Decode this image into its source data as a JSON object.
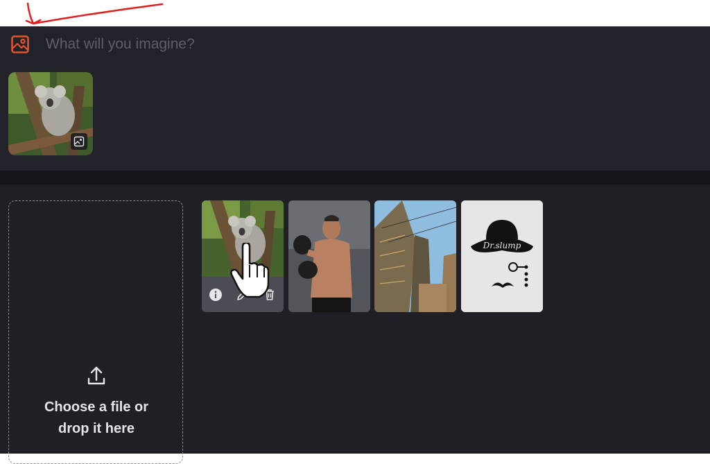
{
  "prompt": {
    "placeholder": "What will you imagine?"
  },
  "prompt_icon": "image-icon",
  "attached_image": {
    "subject": "koala photo",
    "badge_icon": "image-edit-icon"
  },
  "upload": {
    "line1": "Choose a file or",
    "line2": "drop it here",
    "icon": "upload-icon"
  },
  "gallery": {
    "images": [
      {
        "subject": "koala photo",
        "actions": [
          "info-icon",
          "edit-icon",
          "trash-icon"
        ]
      },
      {
        "subject": "boxer photo"
      },
      {
        "subject": "skyscrapers photo"
      },
      {
        "subject": "Dr.slump logo",
        "logo_text": "Dr.slump"
      }
    ]
  },
  "colors": {
    "accent": "#e8542a",
    "panel": "#22222a",
    "annotation": "#e01e1e"
  }
}
